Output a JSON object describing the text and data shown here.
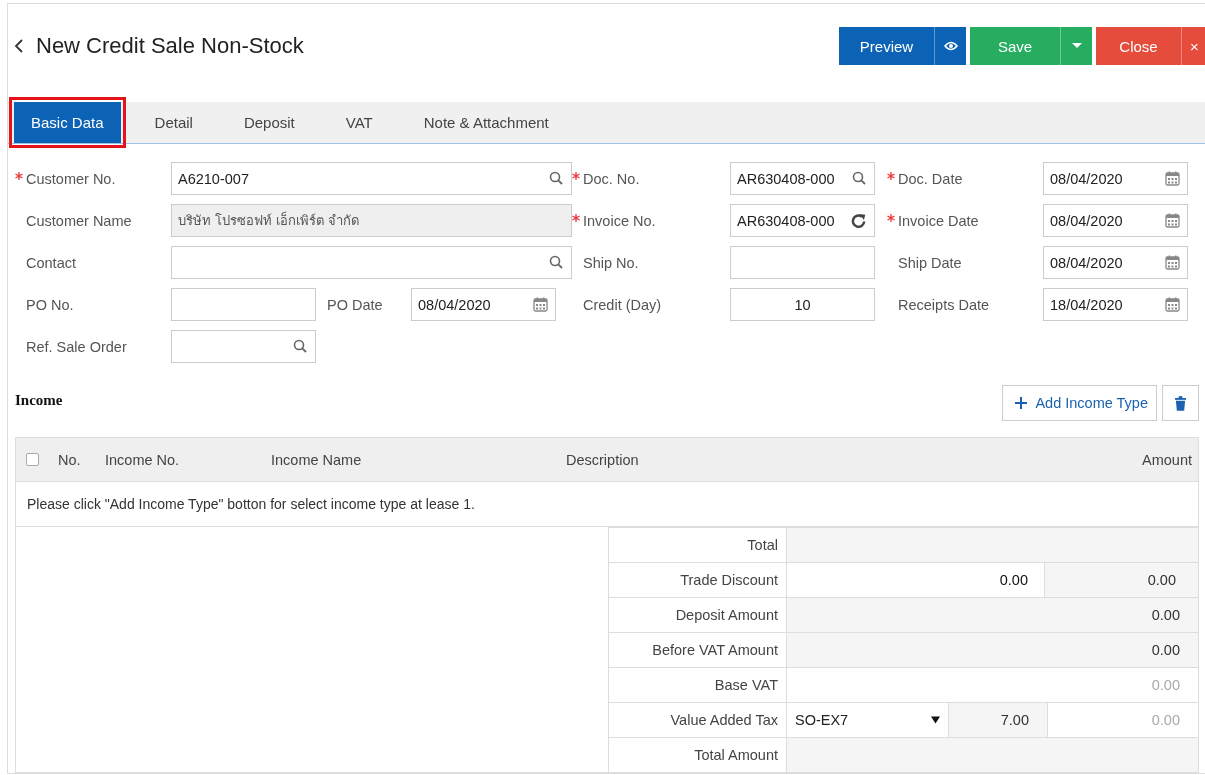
{
  "header": {
    "title": "New Credit Sale Non-Stock",
    "buttons": [
      {
        "label": "Preview",
        "kind": "preview"
      },
      {
        "label": "Save",
        "kind": "save"
      },
      {
        "label": "Close",
        "kind": "close",
        "side_label": "×"
      }
    ]
  },
  "tabs": [
    {
      "label": "Basic Data",
      "selected": true,
      "highlighted": true
    },
    {
      "label": "Detail",
      "selected": false,
      "highlighted": false
    },
    {
      "label": "Deposit",
      "selected": false,
      "highlighted": false
    },
    {
      "label": "VAT",
      "selected": false,
      "highlighted": false
    },
    {
      "label": "Note & Attachment",
      "selected": false,
      "highlighted": false
    }
  ],
  "form": {
    "fields": [
      {
        "label": "Customer No.",
        "required": true,
        "value": "A6210-007",
        "kind": "search",
        "disabled": false
      },
      {
        "label": "Doc. No.",
        "required": true,
        "value": "AR630408-000",
        "kind": "search",
        "disabled": false
      },
      {
        "label": "Doc. Date",
        "required": true,
        "value": "08/04/2020",
        "kind": "date",
        "disabled": false
      },
      {
        "label": "Customer Name",
        "required": false,
        "value": "บริษัท โปรซอฟท์ เอ็กเพิร์ต จำกัด",
        "kind": "plain",
        "disabled": true
      },
      {
        "label": "Invoice No.",
        "required": true,
        "value": "AR630408-000",
        "kind": "refresh",
        "disabled": false
      },
      {
        "label": "Invoice Date",
        "required": true,
        "value": "08/04/2020",
        "kind": "date",
        "disabled": false
      },
      {
        "label": "Contact",
        "required": false,
        "kind": "search",
        "disabled": false
      },
      {
        "label": "Ship No.",
        "required": false,
        "kind": "plain",
        "disabled": false
      },
      {
        "label": "Ship Date",
        "required": false,
        "value": "08/04/2020",
        "kind": "date",
        "disabled": false
      },
      {
        "label": "PO No.",
        "required": false,
        "kind": "plain",
        "disabled": false
      },
      {
        "label": "PO Date",
        "required": false,
        "value": "08/04/2020",
        "kind": "date",
        "disabled": false
      },
      {
        "label": "Credit (Day)",
        "required": false,
        "value": "10",
        "kind": "number",
        "disabled": false
      },
      {
        "label": "Receipts Date",
        "required": false,
        "value": "18/04/2020",
        "kind": "date",
        "disabled": false
      },
      {
        "label": "Ref. Sale Order",
        "required": false,
        "kind": "search",
        "disabled": false
      }
    ]
  },
  "income": {
    "title": "Income",
    "add_button": "Add Income Type",
    "table": {
      "select_all_checked": false,
      "columns": [
        "No.",
        "Income No.",
        "Income Name",
        "Description",
        "Amount"
      ],
      "empty_message": "Please click \"Add Income Type\" botton for select income type at lease 1."
    }
  },
  "summary": [
    {
      "label": "Total",
      "kind": "blank"
    },
    {
      "label": "Trade Discount",
      "kind": "discount",
      "input": "0.00",
      "value": "0.00"
    },
    {
      "label": "Deposit Amount",
      "kind": "amount",
      "value": "0.00"
    },
    {
      "label": "Before VAT Amount",
      "kind": "amount",
      "value": "0.00"
    },
    {
      "label": "Base VAT",
      "kind": "muted",
      "value": "0.00"
    },
    {
      "label": "Value Added Tax",
      "kind": "vat",
      "select": "SO-EX7",
      "rate": "7.00",
      "value": "0.00"
    },
    {
      "label": "Total Amount",
      "kind": "blank"
    }
  ]
}
